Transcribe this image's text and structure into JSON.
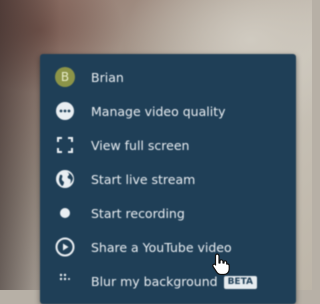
{
  "menu": {
    "items": [
      {
        "label": "Brian",
        "icon": "avatar-icon",
        "avatar_initial": "B"
      },
      {
        "label": "Manage video quality",
        "icon": "settings-dots-icon"
      },
      {
        "label": "View full screen",
        "icon": "fullscreen-icon"
      },
      {
        "label": "Start live stream",
        "icon": "globe-icon"
      },
      {
        "label": "Start recording",
        "icon": "record-dot-icon"
      },
      {
        "label": "Share a YouTube video",
        "icon": "play-circle-icon"
      },
      {
        "label": "Blur my background",
        "icon": "blur-icon",
        "badge": "BETA"
      }
    ]
  },
  "colors": {
    "menu_background": "#1f3f57",
    "menu_text": "#e9eef2",
    "avatar": "#8c9448"
  }
}
